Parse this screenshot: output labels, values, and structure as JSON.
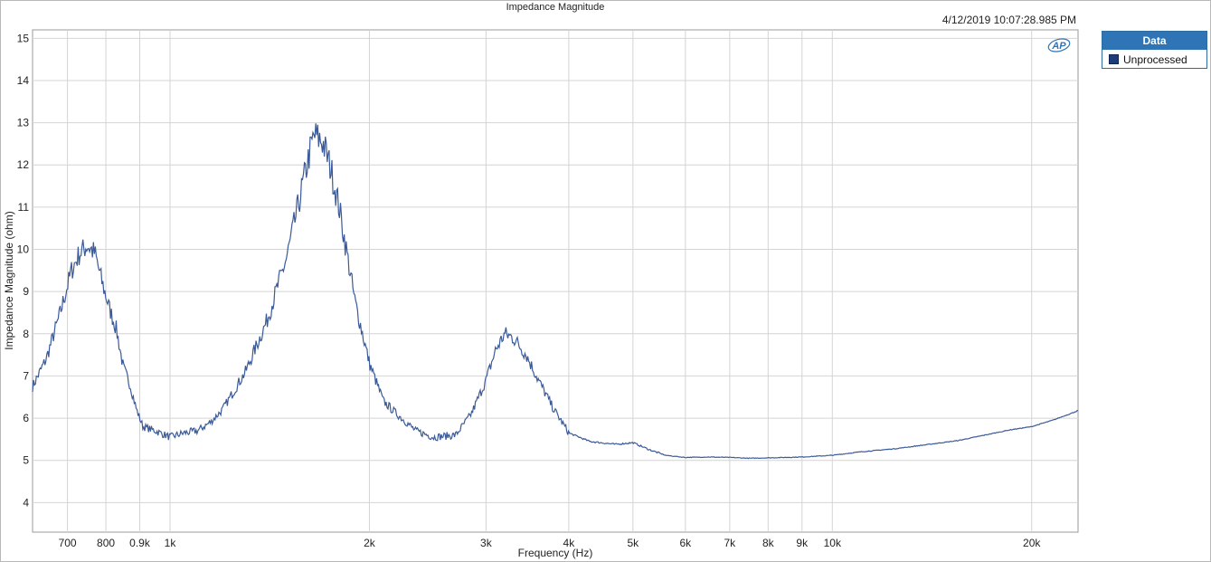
{
  "chart_data": {
    "type": "line",
    "title": "Impedance Magnitude",
    "timestamp": "4/12/2019 10:07:28.985 PM",
    "xlabel": "Frequency (Hz)",
    "ylabel": "Impedance Magnitude (ohm)",
    "x_scale": "log",
    "xlim": [
      620,
      23500
    ],
    "ylim": [
      3.3,
      15.2
    ],
    "grid": true,
    "legend_position": "right",
    "x_ticks": [
      {
        "value": 700,
        "label": "700"
      },
      {
        "value": 800,
        "label": "800"
      },
      {
        "value": 900,
        "label": "0.9k"
      },
      {
        "value": 1000,
        "label": "1k"
      },
      {
        "value": 2000,
        "label": "2k"
      },
      {
        "value": 3000,
        "label": "3k"
      },
      {
        "value": 4000,
        "label": "4k"
      },
      {
        "value": 5000,
        "label": "5k"
      },
      {
        "value": 6000,
        "label": "6k"
      },
      {
        "value": 7000,
        "label": "7k"
      },
      {
        "value": 8000,
        "label": "8k"
      },
      {
        "value": 9000,
        "label": "9k"
      },
      {
        "value": 10000,
        "label": "10k"
      },
      {
        "value": 20000,
        "label": "20k"
      }
    ],
    "y_ticks": [
      4,
      5,
      6,
      7,
      8,
      9,
      10,
      11,
      12,
      13,
      14,
      15
    ],
    "series": [
      {
        "name": "Unprocessed",
        "color": "#3a5a99",
        "points": [
          [
            620,
            6.75
          ],
          [
            650,
            7.4
          ],
          [
            680,
            8.4
          ],
          [
            710,
            9.5
          ],
          [
            730,
            9.9
          ],
          [
            750,
            10.1
          ],
          [
            770,
            9.9
          ],
          [
            790,
            9.2
          ],
          [
            810,
            8.6
          ],
          [
            830,
            8.1
          ],
          [
            850,
            7.2
          ],
          [
            870,
            6.8
          ],
          [
            890,
            6.2
          ],
          [
            910,
            5.8
          ],
          [
            950,
            5.7
          ],
          [
            1000,
            5.55
          ],
          [
            1050,
            5.65
          ],
          [
            1100,
            5.7
          ],
          [
            1150,
            5.9
          ],
          [
            1200,
            6.2
          ],
          [
            1300,
            7.1
          ],
          [
            1400,
            8.3
          ],
          [
            1500,
            9.8
          ],
          [
            1560,
            11.0
          ],
          [
            1620,
            12.2
          ],
          [
            1650,
            12.7
          ],
          [
            1700,
            12.55
          ],
          [
            1750,
            11.9
          ],
          [
            1800,
            11.0
          ],
          [
            1850,
            9.9
          ],
          [
            1900,
            8.8
          ],
          [
            2000,
            7.3
          ],
          [
            2100,
            6.4
          ],
          [
            2200,
            6.1
          ],
          [
            2350,
            5.7
          ],
          [
            2500,
            5.55
          ],
          [
            2700,
            5.6
          ],
          [
            2850,
            6.1
          ],
          [
            3000,
            6.9
          ],
          [
            3100,
            7.6
          ],
          [
            3200,
            8.0
          ],
          [
            3300,
            7.9
          ],
          [
            3450,
            7.5
          ],
          [
            3600,
            6.9
          ],
          [
            3800,
            6.2
          ],
          [
            4000,
            5.65
          ],
          [
            4300,
            5.45
          ],
          [
            4700,
            5.38
          ],
          [
            5000,
            5.42
          ],
          [
            5300,
            5.25
          ],
          [
            5600,
            5.12
          ],
          [
            6000,
            5.07
          ],
          [
            6500,
            5.08
          ],
          [
            7000,
            5.07
          ],
          [
            7500,
            5.05
          ],
          [
            8000,
            5.06
          ],
          [
            9000,
            5.08
          ],
          [
            10000,
            5.12
          ],
          [
            11000,
            5.2
          ],
          [
            12500,
            5.28
          ],
          [
            14000,
            5.38
          ],
          [
            15500,
            5.47
          ],
          [
            17000,
            5.6
          ],
          [
            18500,
            5.72
          ],
          [
            20000,
            5.8
          ],
          [
            21500,
            5.95
          ],
          [
            23000,
            6.12
          ],
          [
            23500,
            6.18
          ]
        ]
      }
    ]
  },
  "legend": {
    "header": "Data",
    "items": [
      "Unprocessed"
    ]
  },
  "logo_text": "AP"
}
